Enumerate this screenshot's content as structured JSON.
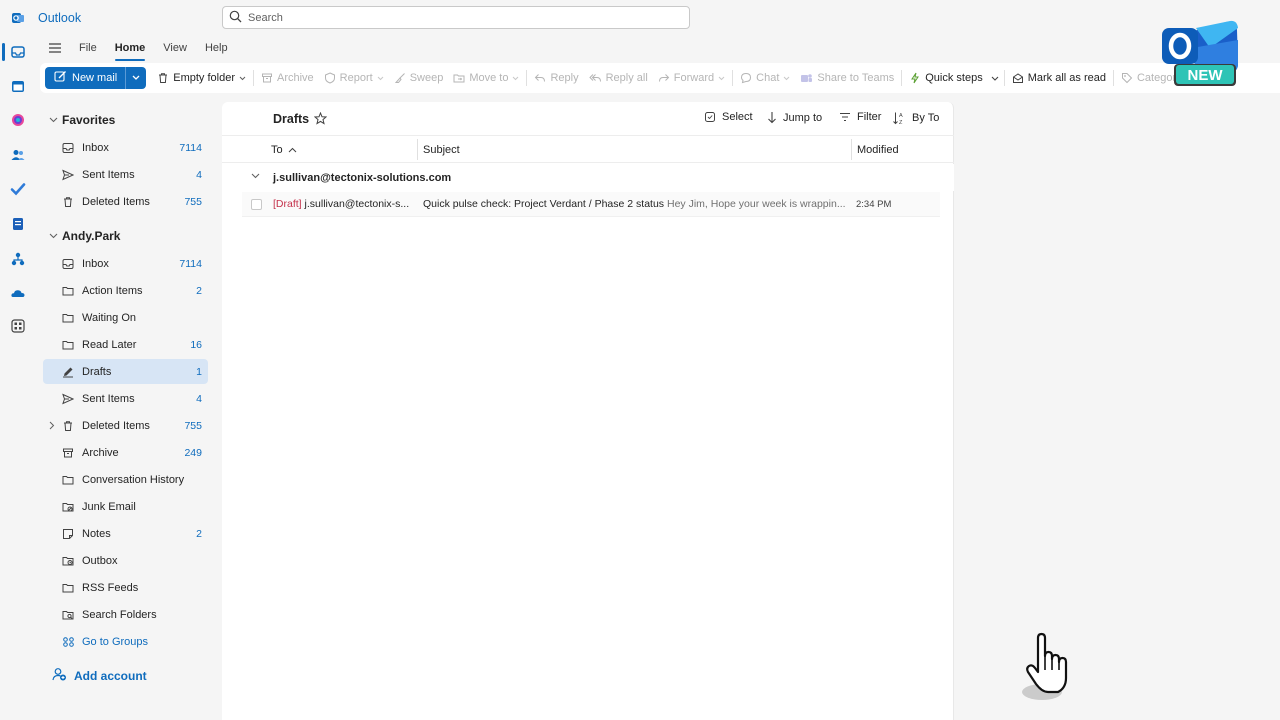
{
  "app": {
    "title": "Outlook"
  },
  "search": {
    "placeholder": "Search"
  },
  "menu": {
    "tabs": [
      "File",
      "Home",
      "View",
      "Help"
    ],
    "active": "Home"
  },
  "ribbon": {
    "new_mail": "New mail",
    "empty_folder": "Empty folder",
    "archive": "Archive",
    "report": "Report",
    "sweep": "Sweep",
    "move_to": "Move to",
    "reply": "Reply",
    "reply_all": "Reply all",
    "forward": "Forward",
    "chat": "Chat",
    "share_to_teams": "Share to Teams",
    "quick_steps": "Quick steps",
    "mark_all_read": "Mark all as read",
    "categorize": "Categorize"
  },
  "logo": {
    "badge": "NEW",
    "letter": "O"
  },
  "sidebar": {
    "favorites": {
      "title": "Favorites",
      "items": [
        {
          "label": "Inbox",
          "count": "7114"
        },
        {
          "label": "Sent Items",
          "count": "4"
        },
        {
          "label": "Deleted Items",
          "count": "755"
        }
      ]
    },
    "account": {
      "title": "Andy.Park",
      "items": [
        {
          "label": "Inbox",
          "count": "7114"
        },
        {
          "label": "Action Items",
          "count": "2"
        },
        {
          "label": "Waiting On",
          "count": ""
        },
        {
          "label": "Read Later",
          "count": "16"
        },
        {
          "label": "Drafts",
          "count": "1"
        },
        {
          "label": "Sent Items",
          "count": "4"
        },
        {
          "label": "Deleted Items",
          "count": "755"
        },
        {
          "label": "Archive",
          "count": "249"
        },
        {
          "label": "Conversation History",
          "count": ""
        },
        {
          "label": "Junk Email",
          "count": ""
        },
        {
          "label": "Notes",
          "count": "2"
        },
        {
          "label": "Outbox",
          "count": ""
        },
        {
          "label": "RSS Feeds",
          "count": ""
        },
        {
          "label": "Search Folders",
          "count": ""
        },
        {
          "label": "Go to Groups",
          "count": ""
        }
      ]
    },
    "add_account": "Add account"
  },
  "list": {
    "title": "Drafts",
    "select": "Select",
    "jump_to": "Jump to",
    "filter": "Filter",
    "sort": "By To",
    "columns": {
      "to": "To",
      "subject": "Subject",
      "modified": "Modified"
    },
    "group": "j.sullivan@tectonix-solutions.com",
    "messages": [
      {
        "tag": "[Draft]",
        "to": "j.sullivan@tectonix-s...",
        "subject": "Quick pulse check: Project Verdant / Phase 2 status",
        "preview": "Hey Jim, Hope your week is wrappin...",
        "time": "2:34 PM"
      }
    ]
  },
  "colors": {
    "accent": "#0f6cbd",
    "selected": "#d7e5f5",
    "draft": "#c4314b"
  }
}
